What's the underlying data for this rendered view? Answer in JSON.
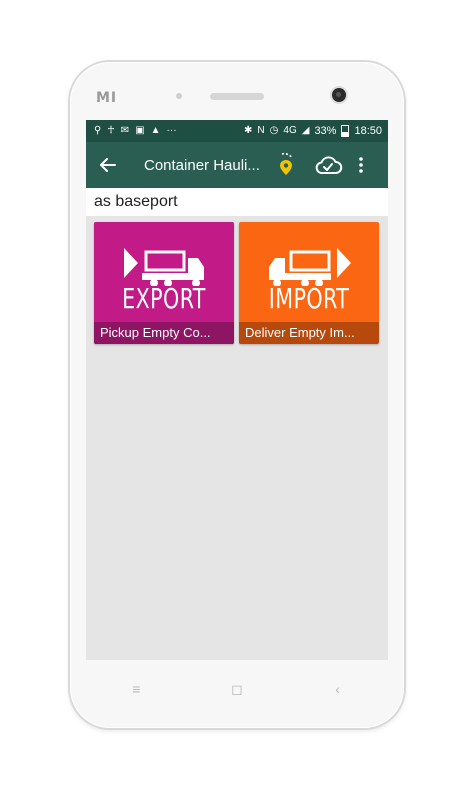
{
  "status_bar": {
    "battery": "33%",
    "time": "18:50",
    "network": "4G"
  },
  "app_bar": {
    "title": "Container Hauli...",
    "back_icon": "arrow-left-icon",
    "gps_icon": "location-pin-icon",
    "sync_icon": "cloud-sync-icon",
    "menu_icon": "more-vert-icon"
  },
  "base": {
    "label": "as baseport"
  },
  "tiles": [
    {
      "word": "EXPORT",
      "caption": "Pickup Empty Co...",
      "color": "#c21a87"
    },
    {
      "word": "IMPORT",
      "caption": "Deliver Empty Im...",
      "color": "#fb6612"
    }
  ],
  "nav": {
    "recent": "≡",
    "home": "◻",
    "back": "‹"
  },
  "colors": {
    "status_bar": "#1f4f43",
    "app_bar": "#2a5e52",
    "gps_accent": "#f2c400"
  }
}
